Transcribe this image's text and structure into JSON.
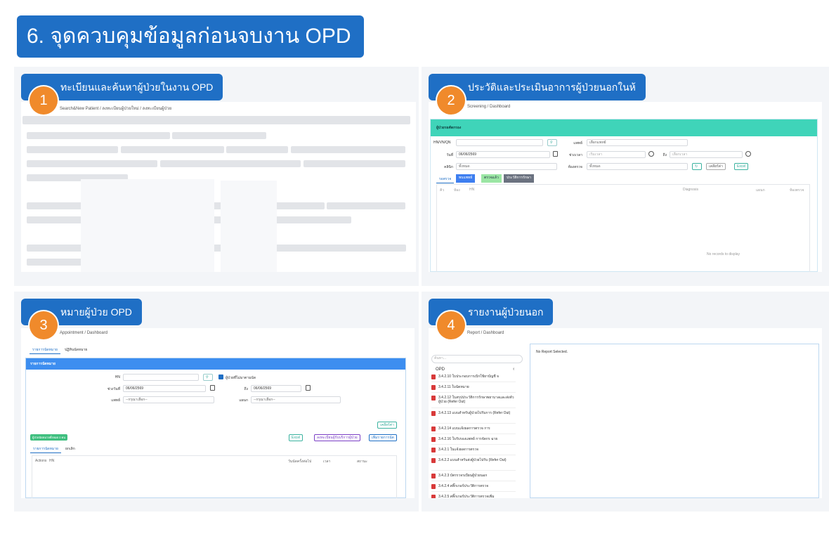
{
  "title": "6. จุดควบคุมข้อมูลก่อนจบงาน OPD",
  "sections": [
    {
      "num": "1",
      "label": "ทะเบียนและค้นหาผู้ป่วยในงาน OPD",
      "breadcrumb": "Search&New Patient / ลงทะเบียนผู้ป่วยใหม่ / ลงทะเบียนผู้ป่วย"
    },
    {
      "num": "2",
      "label": "ประวัติและประเมินอาการผู้ป่วยนอกในห้",
      "breadcrumb": "Screening / Dashboard"
    },
    {
      "num": "3",
      "label": "หมายผู้ป่วย OPD",
      "breadcrumb": "Appointment / Dashboard"
    },
    {
      "num": "4",
      "label": "รายงานผู้ป่วยนอก",
      "breadcrumb": "Report / Dashboard"
    }
  ],
  "screening": {
    "header": "ผู้ป่วยรอคัดกรอง",
    "hn_label": "HN/VN/QN",
    "doctor_label": "แพทย์",
    "doctor_value": "เลือกแพทย์",
    "date_label": "วันที่",
    "date_value": "06/06/2569",
    "time_label": "ช่วงเวลา",
    "time_from": "เริ่มเวลา",
    "time_to_label": "ถึง",
    "time_to": "เลือกเวลา",
    "clinic_label": "คลินิก",
    "clinic_value": "ทั้งหมด",
    "room_label": "ห้องตรวจ",
    "room_value": "ทั้งหมด",
    "clear_btn": "เคลียร์ค่า",
    "excel_btn": "Excel",
    "tabs": [
      "รอตรวจ",
      "พบแพทย์",
      "ตรวจแล้ว",
      "ประวัติการรักษา"
    ],
    "columns": [
      "คิว",
      "ห้อง",
      "HN",
      "Diagnosis",
      "แผนก",
      "ห้องตรวจ"
    ],
    "empty": "No records to display"
  },
  "appointment": {
    "tabs": [
      "รายการนัดหมาย",
      "ปฏิทินนัดหมาย"
    ],
    "header": "รายการนัดหมาย",
    "hn_label": "HN",
    "not_show_label": "ผู้ป่วยที่ไม่มาตามนัด",
    "range_label": "ช่วงวันที่",
    "from_date": "06/06/2569",
    "to_label": "ถึง",
    "to_date": "06/06/2569",
    "doctor_label": "แพทย์",
    "doctor_value": "--กรุณาเลือก--",
    "dept_label": "แผนก",
    "dept_value": "--กรุณาเลือก--",
    "clear_btn": "เคลียร์ค่า",
    "count_badge": "ผู้ป่วยนัดหมายทั้งหมด 0 คน",
    "excel_btn": "Excel",
    "print_btn": "ลงทะเบียนผู้รับบริการผู้ป่วย",
    "add_btn": "เพิ่มรายการนัด",
    "subtabs": [
      "รายการนัดหมาย",
      "ยกเลิก"
    ],
    "columns": [
      "Actions",
      "HN",
      "วันนัดครั้งต่อไป",
      "เวลา",
      "สถานะ"
    ]
  },
  "report": {
    "search_placeholder": "ค้นหา...",
    "folder": "OPD",
    "no_report": "No Report Selected.",
    "items": [
      "3.4.2.10 ใบประกอบการเบิกใช้ยาบัญชี จ",
      "3.4.2.11 ใบนัดหมาย",
      "3.4.2.12 ใบสรุปประวัติการรักษาพยาบาลและส่งตัวผู้ป่วย (Refer Out)",
      "3.4.2.13 แบบสำหรับผู้ป่วยไปรับการ (Refer Out)",
      "3.4.2.14 แบบแจ้งผลการตรวจ การ",
      "3.4.2.16 ใบรับรองแพทย์ การจัดกร ฉาย",
      "3.4.2.1 ใบแจ้งผลการตรวจ",
      "3.4.2.2 แบบสำหรับส่งผู้ป่วยไปรับ (Refer Out)",
      "3.4.2.3 บัตรรวจรเบียนผู้ป่วยนอก",
      "3.4.2.4 สติ๊กเกอร์ประวัติการตรวจ",
      "3.4.2.5 สติ๊กเกอร์ประวัติการตรวจเพิ่ม"
    ]
  }
}
